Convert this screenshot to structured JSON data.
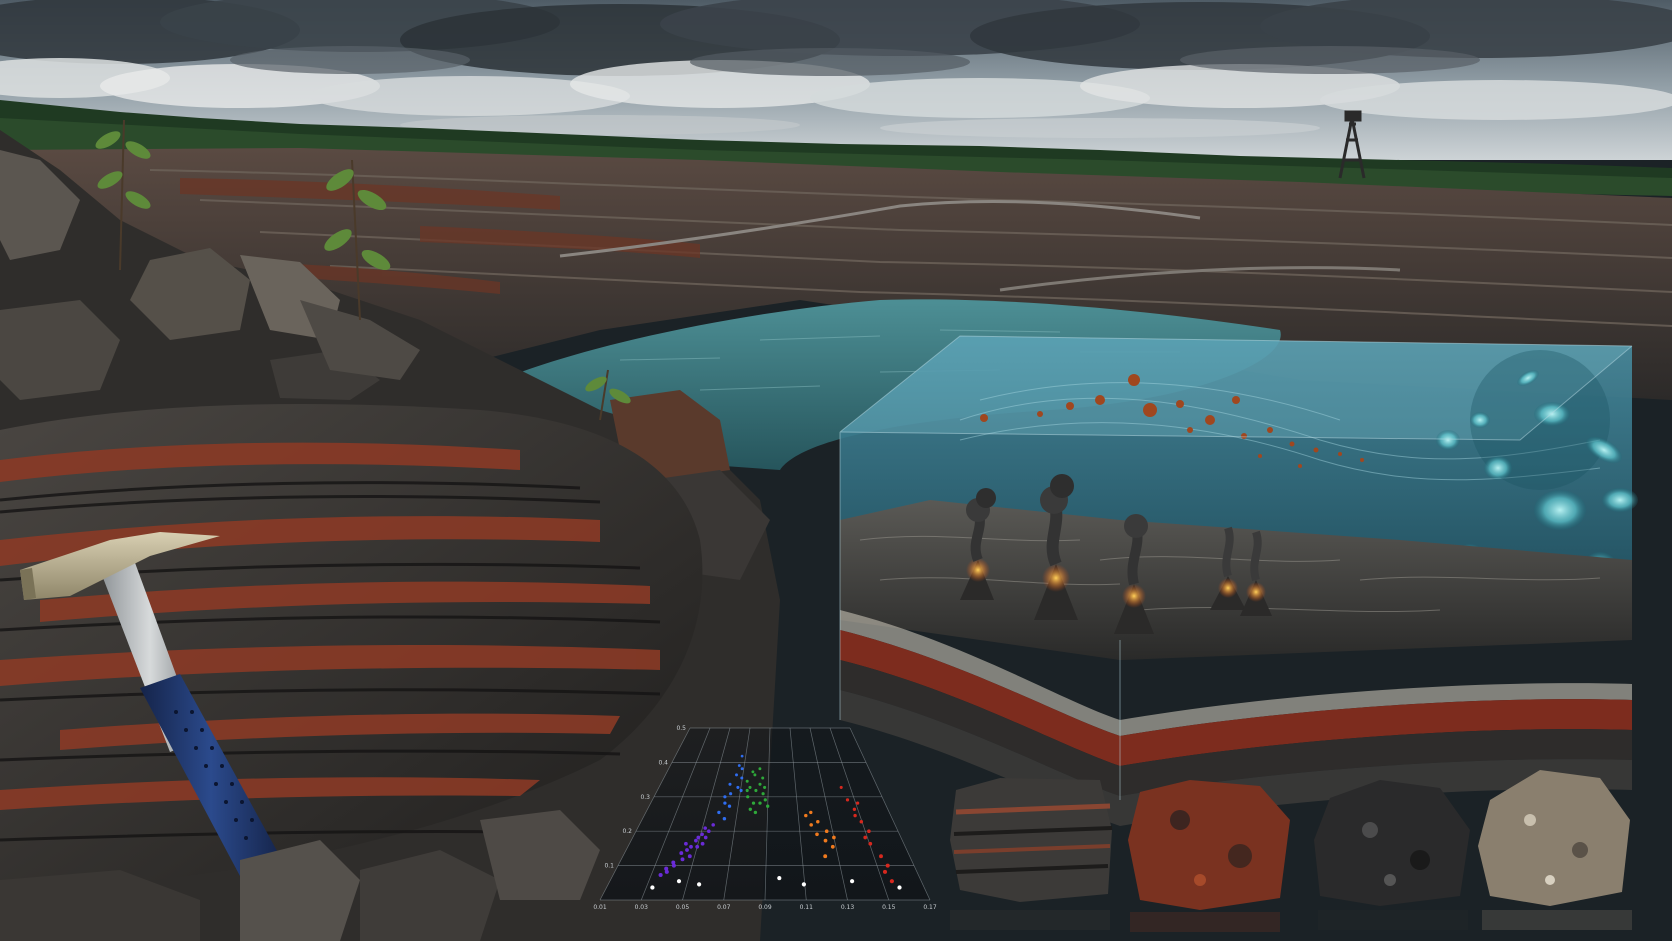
{
  "scene": {
    "subject": "open-pit-quarry-with-banded-iron-formation",
    "colors": {
      "sky_top": "#5d6a74",
      "sky_horizon": "#c9d0d4",
      "cloud_light": "#e4e6e6",
      "cloud_dark": "#4a535a",
      "forest": "#1f3a22",
      "pit_wall": "#4a4440",
      "pit_rust": "#6b3626",
      "lake": "#3f7f86",
      "rock_dark": "#2e2c2b",
      "rock_band_red": "#8a3a26",
      "hammer_head": "#b8ad90",
      "hammer_grip": "#1e3366",
      "ocean_panel": "#2a6f86",
      "microbe_glow": "#7fe3e6",
      "lava": "#ff7a1a",
      "sediment_red": "#7d2c1e"
    }
  },
  "chart_data": {
    "type": "scatter",
    "axis_ticks": {
      "x": [
        "0.01",
        "0.03",
        "0.05",
        "0.07",
        "0.09",
        "0.11",
        "0.13",
        "0.15",
        "0.17"
      ],
      "y": [
        "0.5",
        "0.4",
        "0.3",
        "0.2",
        "0.1"
      ]
    },
    "series": [
      {
        "color": "#6a2bd8",
        "points": [
          [
            0.028,
            0.08
          ],
          [
            0.03,
            0.1
          ],
          [
            0.033,
            0.12
          ],
          [
            0.036,
            0.15
          ],
          [
            0.038,
            0.13
          ],
          [
            0.041,
            0.17
          ],
          [
            0.043,
            0.19
          ],
          [
            0.046,
            0.21
          ],
          [
            0.048,
            0.18
          ],
          [
            0.05,
            0.22
          ],
          [
            0.052,
            0.24
          ],
          [
            0.034,
            0.11
          ],
          [
            0.039,
            0.16
          ],
          [
            0.044,
            0.2
          ],
          [
            0.031,
            0.09
          ],
          [
            0.047,
            0.23
          ],
          [
            0.049,
            0.2
          ],
          [
            0.042,
            0.14
          ],
          [
            0.037,
            0.18
          ],
          [
            0.045,
            0.17
          ]
        ]
      },
      {
        "color": "#2f6df0",
        "points": [
          [
            0.054,
            0.28
          ],
          [
            0.057,
            0.31
          ],
          [
            0.06,
            0.34
          ],
          [
            0.058,
            0.37
          ],
          [
            0.062,
            0.4
          ],
          [
            0.065,
            0.36
          ],
          [
            0.063,
            0.43
          ],
          [
            0.067,
            0.39
          ],
          [
            0.061,
            0.3
          ],
          [
            0.056,
            0.33
          ],
          [
            0.064,
            0.46
          ],
          [
            0.066,
            0.42
          ],
          [
            0.059,
            0.26
          ],
          [
            0.068,
            0.35
          ]
        ]
      },
      {
        "color": "#2ea83a",
        "points": [
          [
            0.072,
            0.38
          ],
          [
            0.075,
            0.36
          ],
          [
            0.078,
            0.4
          ],
          [
            0.08,
            0.35
          ],
          [
            0.083,
            0.37
          ],
          [
            0.086,
            0.34
          ],
          [
            0.079,
            0.31
          ],
          [
            0.074,
            0.33
          ],
          [
            0.082,
            0.42
          ],
          [
            0.088,
            0.32
          ],
          [
            0.077,
            0.29
          ],
          [
            0.085,
            0.39
          ],
          [
            0.09,
            0.3
          ],
          [
            0.081,
            0.28
          ],
          [
            0.076,
            0.41
          ],
          [
            0.087,
            0.36
          ],
          [
            0.073,
            0.35
          ],
          [
            0.084,
            0.31
          ]
        ]
      },
      {
        "color": "#f07a1e",
        "points": [
          [
            0.118,
            0.27
          ],
          [
            0.121,
            0.24
          ],
          [
            0.124,
            0.21
          ],
          [
            0.126,
            0.25
          ],
          [
            0.129,
            0.19
          ],
          [
            0.131,
            0.22
          ],
          [
            0.133,
            0.17
          ],
          [
            0.122,
            0.28
          ],
          [
            0.127,
            0.14
          ],
          [
            0.135,
            0.2
          ]
        ]
      },
      {
        "color": "#d6281e",
        "points": [
          [
            0.15,
            0.36
          ],
          [
            0.152,
            0.32
          ],
          [
            0.155,
            0.29
          ],
          [
            0.157,
            0.25
          ],
          [
            0.16,
            0.22
          ],
          [
            0.158,
            0.18
          ],
          [
            0.162,
            0.14
          ],
          [
            0.164,
            0.11
          ],
          [
            0.154,
            0.27
          ],
          [
            0.161,
            0.09
          ],
          [
            0.163,
            0.06
          ],
          [
            0.156,
            0.2
          ],
          [
            0.159,
            0.31
          ]
        ]
      },
      {
        "color": "#ffffff",
        "points": [
          [
            0.026,
            0.04
          ],
          [
            0.04,
            0.06
          ],
          [
            0.052,
            0.05
          ],
          [
            0.098,
            0.07
          ],
          [
            0.112,
            0.05
          ],
          [
            0.14,
            0.06
          ],
          [
            0.166,
            0.04
          ]
        ]
      }
    ],
    "xlim": [
      0.0,
      0.18
    ],
    "ylim": [
      0.0,
      0.55
    ],
    "grid": true
  }
}
